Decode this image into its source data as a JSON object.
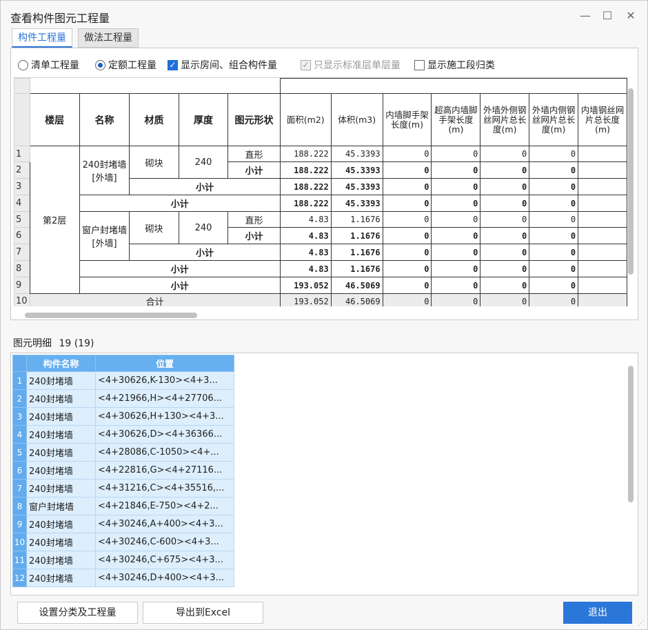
{
  "window": {
    "title": "查看构件图元工程量",
    "minimize_glyph": "—",
    "maximize_glyph": "☐",
    "close_glyph": "✕"
  },
  "tabs": [
    {
      "label": "构件工程量",
      "active": true
    },
    {
      "label": "做法工程量",
      "active": false
    }
  ],
  "options": {
    "list_qty": "清单工程量",
    "quota_qty": "定额工程量",
    "show_rooms": "显示房间、组合构件量",
    "std_floor": "只显示标准层单层量",
    "show_phase": "显示施工段归类"
  },
  "grid": {
    "headers": {
      "floor": "楼层",
      "name": "名称",
      "material": "材质",
      "thickness": "厚度",
      "shape": "图元形状",
      "area": "面积(m2)",
      "volume": "体积(m3)",
      "c1": "内墙脚手架长度(m)",
      "c2": "超高内墙脚手架长度(m)",
      "c3": "外墙外侧钢丝网片总长度(m)",
      "c4": "外墙内侧钢丝网片总长度(m)",
      "c5": "内墙钢丝网片总长度(m)"
    },
    "row_numbers": [
      "1",
      "2",
      "3",
      "4",
      "5",
      "6",
      "7",
      "8",
      "9",
      "10"
    ],
    "floor": "第2层",
    "g1": {
      "name": "240封堵墙[外墙]",
      "material": "砌块",
      "thickness": "240",
      "shape": "直形",
      "r1": [
        "188.222",
        "45.3393",
        "0",
        "0",
        "0",
        "0"
      ],
      "sub_label": "小计",
      "r2": [
        "188.222",
        "45.3393",
        "0",
        "0",
        "0",
        "0"
      ],
      "r3": [
        "188.222",
        "45.3393",
        "0",
        "0",
        "0",
        "0"
      ],
      "r4": [
        "188.222",
        "45.3393",
        "0",
        "0",
        "0",
        "0"
      ]
    },
    "g2": {
      "name": "窗户封堵墙[外墙]",
      "material": "砌块",
      "thickness": "240",
      "shape": "直形",
      "r5": [
        "4.83",
        "1.1676",
        "0",
        "0",
        "0",
        "0"
      ],
      "r6": [
        "4.83",
        "1.1676",
        "0",
        "0",
        "0",
        "0"
      ],
      "r7": [
        "4.83",
        "1.1676",
        "0",
        "0",
        "0",
        "0"
      ],
      "r8": [
        "4.83",
        "1.1676",
        "0",
        "0",
        "0",
        "0"
      ]
    },
    "r9": [
      "193.052",
      "46.5069",
      "0",
      "0",
      "0",
      "0"
    ],
    "total_label": "合计",
    "r10": [
      "193.052",
      "46.5069",
      "0",
      "0",
      "0",
      "0"
    ]
  },
  "detail": {
    "label": "图元明细",
    "count": "19 (19)",
    "col_name": "构件名称",
    "col_pos": "位置",
    "rows": [
      {
        "no": "1",
        "name": "240封堵墙",
        "pos": "<4+30626,K-130><4+3..."
      },
      {
        "no": "2",
        "name": "240封堵墙",
        "pos": "<4+21966,H><4+27706..."
      },
      {
        "no": "3",
        "name": "240封堵墙",
        "pos": "<4+30626,H+130><4+3..."
      },
      {
        "no": "4",
        "name": "240封堵墙",
        "pos": "<4+30626,D><4+36366..."
      },
      {
        "no": "5",
        "name": "240封堵墙",
        "pos": "<4+28086,C-1050><4+..."
      },
      {
        "no": "6",
        "name": "240封堵墙",
        "pos": "<4+22816,G><4+27116..."
      },
      {
        "no": "7",
        "name": "240封堵墙",
        "pos": "<4+31216,C><4+35516,..."
      },
      {
        "no": "8",
        "name": "窗户封堵墙",
        "pos": "<4+21846,E-750><4+2..."
      },
      {
        "no": "9",
        "name": "240封堵墙",
        "pos": "<4+30246,A+400><4+3..."
      },
      {
        "no": "10",
        "name": "240封堵墙",
        "pos": "<4+30246,C-600><4+3..."
      },
      {
        "no": "11",
        "name": "240封堵墙",
        "pos": "<4+30246,C+675><4+3..."
      },
      {
        "no": "12",
        "name": "240封堵墙",
        "pos": "<4+30246,D+400><4+3..."
      }
    ]
  },
  "buttons": {
    "set_category": "设置分类及工程量",
    "export_excel": "导出到Excel",
    "exit": "退出"
  }
}
